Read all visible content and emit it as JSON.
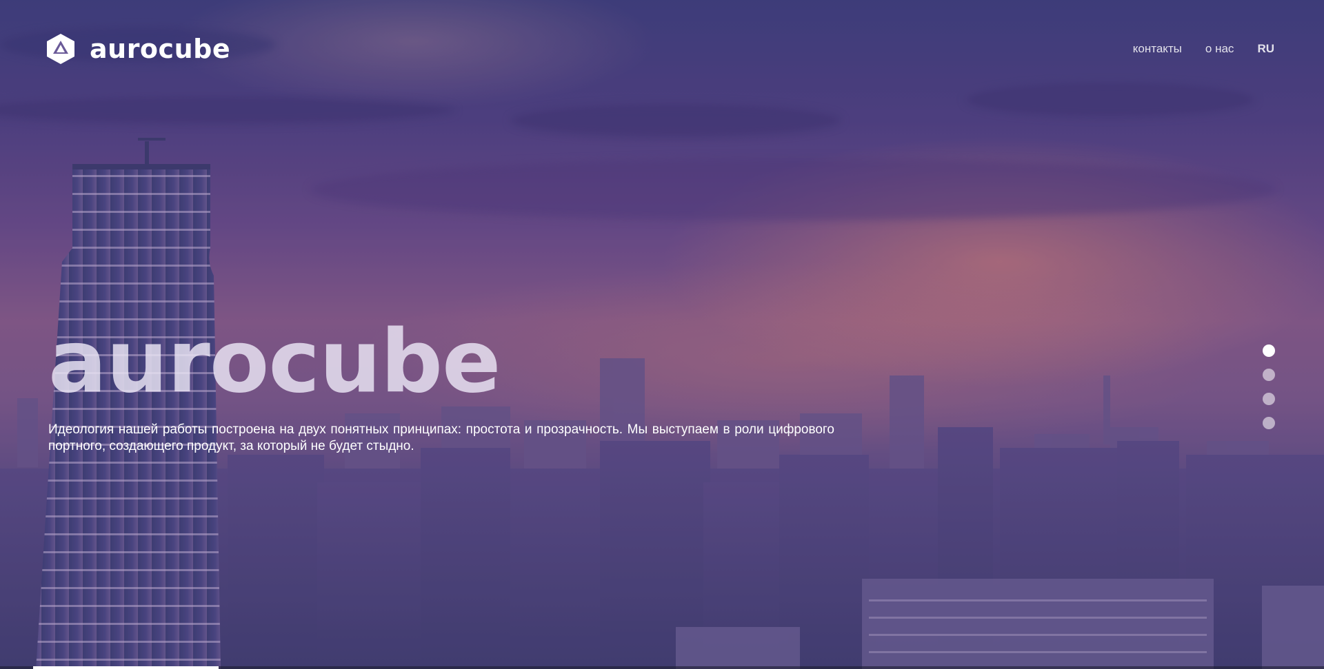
{
  "header": {
    "logo_text": "aurocube",
    "logo_icon": "cube-triangle-logo-icon",
    "nav": {
      "contacts_label": "контакты",
      "about_label": "о нас",
      "lang_label": "RU"
    }
  },
  "hero": {
    "title": "aurocube",
    "description": "Идеология нашей работы построена на двух понятных принципах: простота и прозрачность. Мы выступаем в роли цифрового портного, создающего продукт, за который не будет стыдно."
  },
  "slider": {
    "slide_count": 4,
    "active_index": 0,
    "progress": 0.14
  },
  "colors": {
    "accent": "#ffffff",
    "background_top": "#3b3c78",
    "background_mid": "#8a5b86",
    "sunset_glow": "#f08c6e"
  }
}
